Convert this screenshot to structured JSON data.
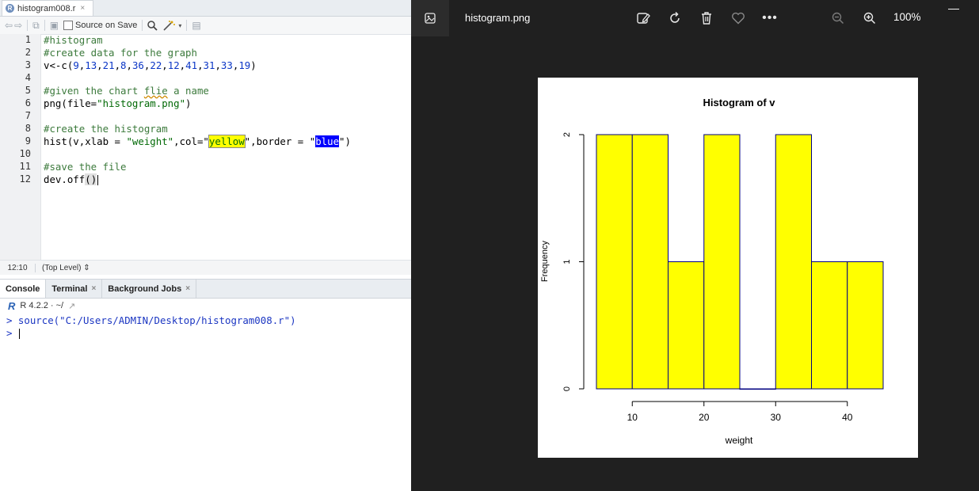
{
  "editor": {
    "file_tab": "histogram008.r",
    "source_on_save": "Source on Save",
    "lines": [
      "#histogram",
      "#create data for the graph",
      "v<-c(9,13,21,8,36,22,12,41,31,33,19)",
      "",
      "#given the chart flie a name",
      "png(file=\"histogram.png\")",
      "",
      "#create the histogram",
      "hist(v,xlab = \"weight\",col=\"yellow\",border = \"blue\")",
      "",
      "#save the file",
      "dev.off()"
    ],
    "line_numbers": [
      "1",
      "2",
      "3",
      "4",
      "5",
      "6",
      "7",
      "8",
      "9",
      "10",
      "11",
      "12"
    ],
    "status_position": "12:10",
    "status_scope": "(Top Level) ⇕"
  },
  "console": {
    "tabs": [
      "Console",
      "Terminal",
      "Background Jobs"
    ],
    "r_version": "R 4.2.2 · ~/",
    "lines": [
      "> source(\"C:/Users/ADMIN/Desktop/histogram008.r\")",
      "> "
    ]
  },
  "viewer": {
    "filename": "histogram.png",
    "zoom": "100%",
    "icons": [
      "gallery-icon",
      "edit-icon",
      "rotate-icon",
      "delete-icon",
      "favorite-icon",
      "more-icon",
      "zoom-out-icon",
      "zoom-in-icon"
    ]
  },
  "chart_data": {
    "type": "bar",
    "title": "Histogram of v",
    "xlabel": "weight",
    "ylabel": "Frequency",
    "bins": [
      [
        5,
        10
      ],
      [
        10,
        15
      ],
      [
        15,
        20
      ],
      [
        20,
        25
      ],
      [
        25,
        30
      ],
      [
        30,
        35
      ],
      [
        35,
        40
      ],
      [
        40,
        45
      ]
    ],
    "values": [
      2,
      2,
      1,
      2,
      0,
      2,
      1,
      1
    ],
    "xticks": [
      10,
      20,
      30,
      40
    ],
    "yticks": [
      0,
      1,
      2
    ],
    "xlim": [
      5,
      45
    ],
    "ylim": [
      0,
      2
    ],
    "fill_color": "#ffff00",
    "border_color": "#000080"
  }
}
